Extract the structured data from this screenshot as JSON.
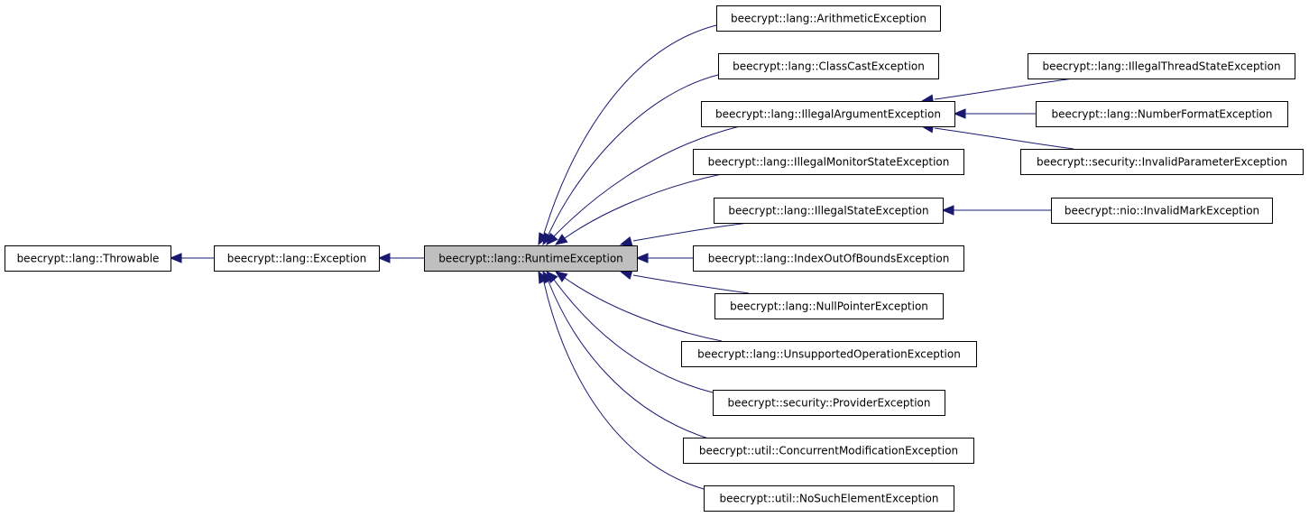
{
  "diagram": {
    "type": "class-inheritance-graph",
    "edge_color": "#191970",
    "highlight_fill": "#bfbfbf",
    "node_fill": "#ffffff",
    "nodes": [
      {
        "id": "throwable",
        "label": "beecrypt::lang::Throwable"
      },
      {
        "id": "exception",
        "label": "beecrypt::lang::Exception"
      },
      {
        "id": "runtime",
        "label": "beecrypt::lang::RuntimeException",
        "highlighted": true
      },
      {
        "id": "arith",
        "label": "beecrypt::lang::ArithmeticException"
      },
      {
        "id": "classcast",
        "label": "beecrypt::lang::ClassCastException"
      },
      {
        "id": "illegalarg",
        "label": "beecrypt::lang::IllegalArgumentException"
      },
      {
        "id": "illegalmon",
        "label": "beecrypt::lang::IllegalMonitorStateException"
      },
      {
        "id": "illegalstate",
        "label": "beecrypt::lang::IllegalStateException"
      },
      {
        "id": "indexoob",
        "label": "beecrypt::lang::IndexOutOfBoundsException"
      },
      {
        "id": "nullptr",
        "label": "beecrypt::lang::NullPointerException"
      },
      {
        "id": "unsupported",
        "label": "beecrypt::lang::UnsupportedOperationException"
      },
      {
        "id": "provider",
        "label": "beecrypt::security::ProviderException"
      },
      {
        "id": "concurrent",
        "label": "beecrypt::util::ConcurrentModificationException"
      },
      {
        "id": "nosuch",
        "label": "beecrypt::util::NoSuchElementException"
      },
      {
        "id": "illegalthread",
        "label": "beecrypt::lang::IllegalThreadStateException"
      },
      {
        "id": "numformat",
        "label": "beecrypt::lang::NumberFormatException"
      },
      {
        "id": "invalidparam",
        "label": "beecrypt::security::InvalidParameterException"
      },
      {
        "id": "invalidmark",
        "label": "beecrypt::nio::InvalidMarkException"
      }
    ],
    "edges": [
      {
        "from": "exception",
        "to": "throwable"
      },
      {
        "from": "runtime",
        "to": "exception"
      },
      {
        "from": "arith",
        "to": "runtime"
      },
      {
        "from": "classcast",
        "to": "runtime"
      },
      {
        "from": "illegalarg",
        "to": "runtime"
      },
      {
        "from": "illegalmon",
        "to": "runtime"
      },
      {
        "from": "illegalstate",
        "to": "runtime"
      },
      {
        "from": "indexoob",
        "to": "runtime"
      },
      {
        "from": "nullptr",
        "to": "runtime"
      },
      {
        "from": "unsupported",
        "to": "runtime"
      },
      {
        "from": "provider",
        "to": "runtime"
      },
      {
        "from": "concurrent",
        "to": "runtime"
      },
      {
        "from": "nosuch",
        "to": "runtime"
      },
      {
        "from": "illegalthread",
        "to": "illegalarg"
      },
      {
        "from": "numformat",
        "to": "illegalarg"
      },
      {
        "from": "invalidparam",
        "to": "illegalarg"
      },
      {
        "from": "invalidmark",
        "to": "illegalstate"
      }
    ]
  }
}
